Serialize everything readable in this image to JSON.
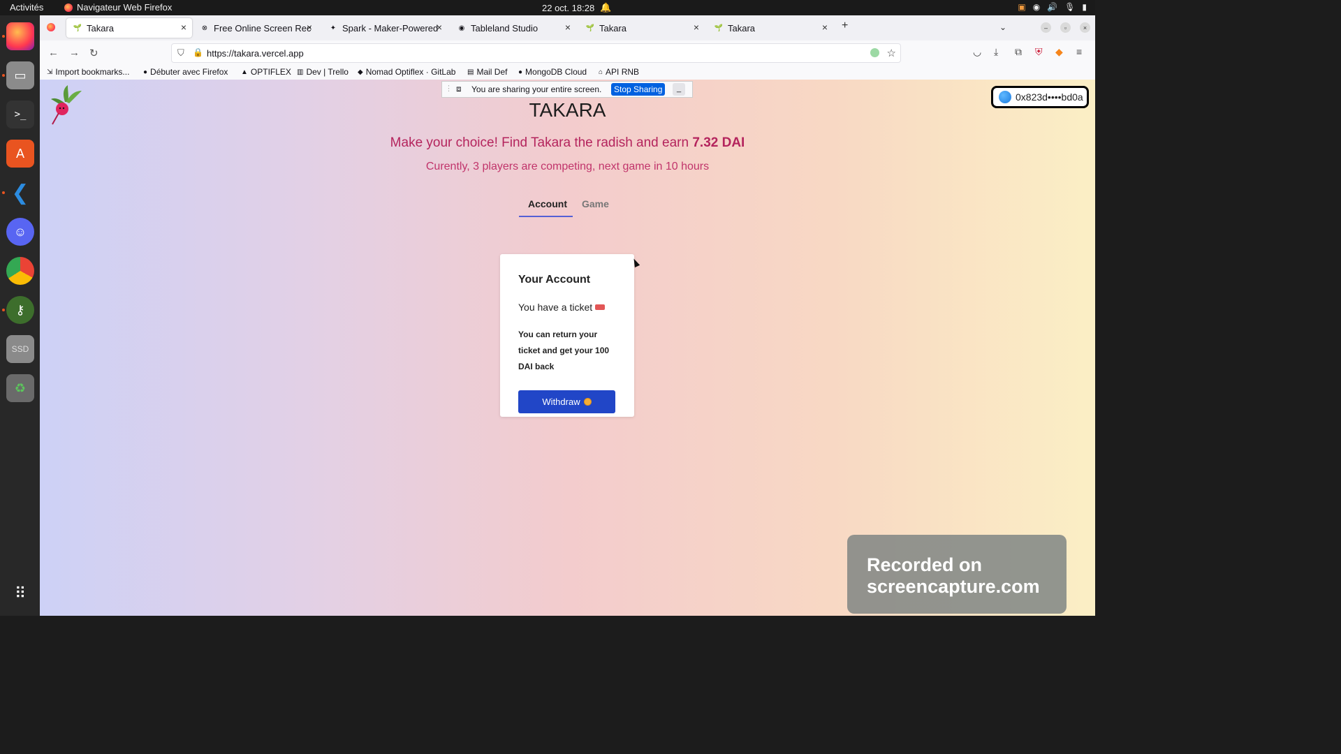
{
  "topbar": {
    "activities": "Activités",
    "app_name": "Navigateur Web Firefox",
    "clock": "22 oct.  18:28"
  },
  "browser": {
    "tabs": [
      {
        "title": "Takara"
      },
      {
        "title": "Free Online Screen Recor"
      },
      {
        "title": "Spark - Maker-Powered L"
      },
      {
        "title": "Tableland Studio"
      },
      {
        "title": "Takara"
      },
      {
        "title": "Takara"
      }
    ],
    "url": "https://takara.vercel.app",
    "bookmarks": [
      "Import bookmarks...",
      "Débuter avec Firefox",
      "OPTIFLEX",
      "Dev | Trello",
      "Nomad Optiflex · GitLab",
      "Mail Def",
      "MongoDB Cloud",
      "API RNB"
    ]
  },
  "share": {
    "text": "You are sharing your entire screen.",
    "stop_label": "Stop Sharing",
    "minimize_label": "_"
  },
  "wallet": {
    "address": "0x823d••••bd0a"
  },
  "page": {
    "title": "TAKARA",
    "headline_prefix": "Make your choice! Find Takara the radish and earn ",
    "headline_amount": "7.32 DAI",
    "subline": "Curently, 3 players are competing, next game in 10 hours",
    "tabs": [
      {
        "label": "Account"
      },
      {
        "label": "Game"
      }
    ]
  },
  "account_card": {
    "title": "Your Account",
    "ticket_text": "You have a ticket",
    "info": "You can return your ticket and get your 100 DAI back",
    "withdraw_label": "Withdraw"
  },
  "watermark": {
    "line1": "Recorded on",
    "line2": "screencapture.com"
  },
  "colors": {
    "accent": "#b4245d",
    "button": "#2146c7",
    "tab_underline": "#5460d6"
  }
}
